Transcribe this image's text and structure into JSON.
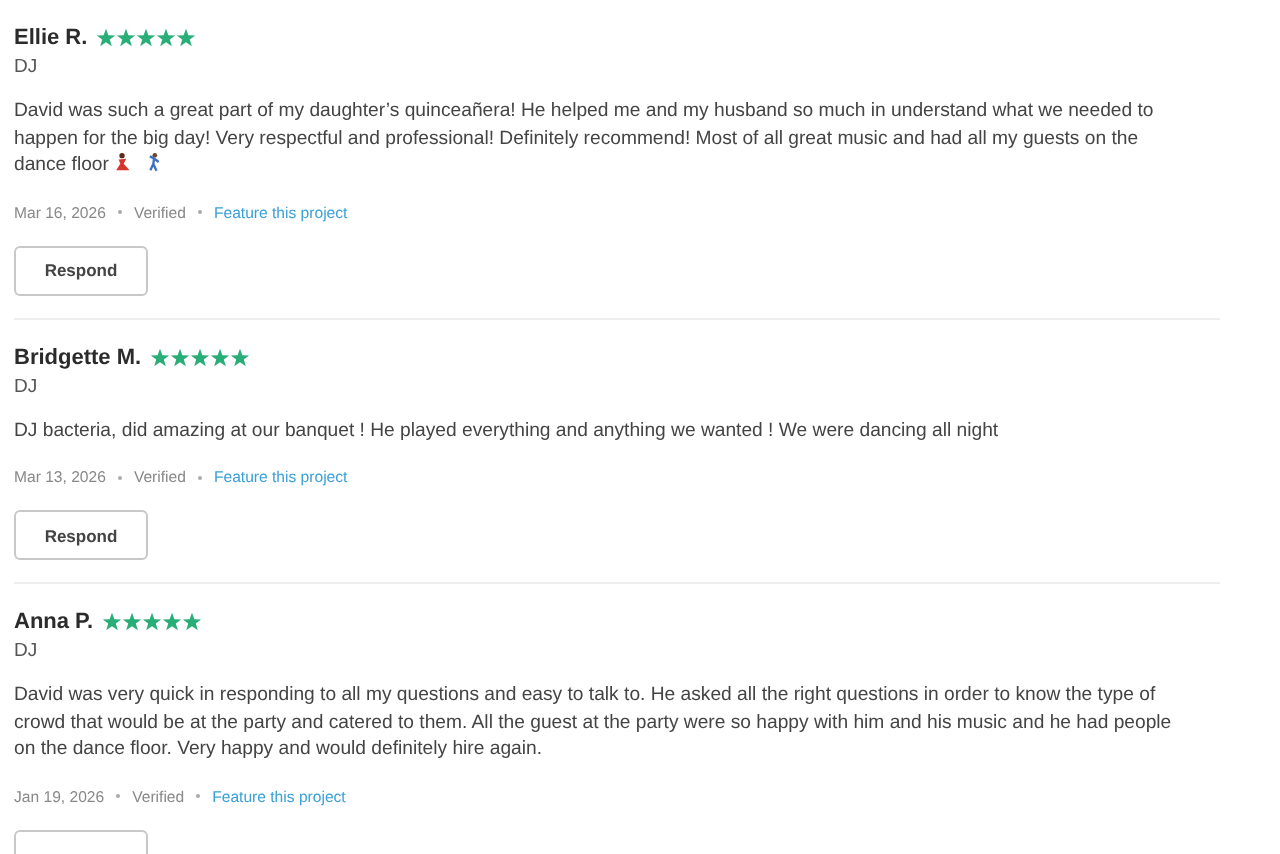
{
  "reviews": [
    {
      "name": "Ellie R.",
      "stars": 5,
      "service": "DJ",
      "body": "David was such a great part of my daughter’s quinceañera! He helped me and my husband so much in understand what we needed to happen for the big day! Very respectful and professional! Definitely recommend! Most of all great music and had all my guests on the dance floor",
      "emoji": true,
      "date": "Mar 16, 2026",
      "status": "Verified",
      "link": "Feature this project",
      "respond": "Respond"
    },
    {
      "name": "Bridgette M.",
      "stars": 5,
      "service": "DJ",
      "body": "DJ bacteria, did amazing at our banquet ! He played everything and anything we wanted ! We were dancing all night",
      "emoji": false,
      "date": "Mar 13, 2026",
      "status": "Verified",
      "link": "Feature this project",
      "respond": "Respond"
    },
    {
      "name": "Anna P.",
      "stars": 5,
      "service": "DJ",
      "body": "David was very quick in responding to all my questions and easy to talk to. He asked all the right questions in order to know the type of crowd that would be at the party and catered to them. All the guest at the party were so happy with him and his music and he had people on the dance floor. Very happy and would definitely hire again.",
      "emoji": false,
      "date": "Jan 19, 2026",
      "status": "Verified",
      "link": "Feature this project"
    }
  ]
}
